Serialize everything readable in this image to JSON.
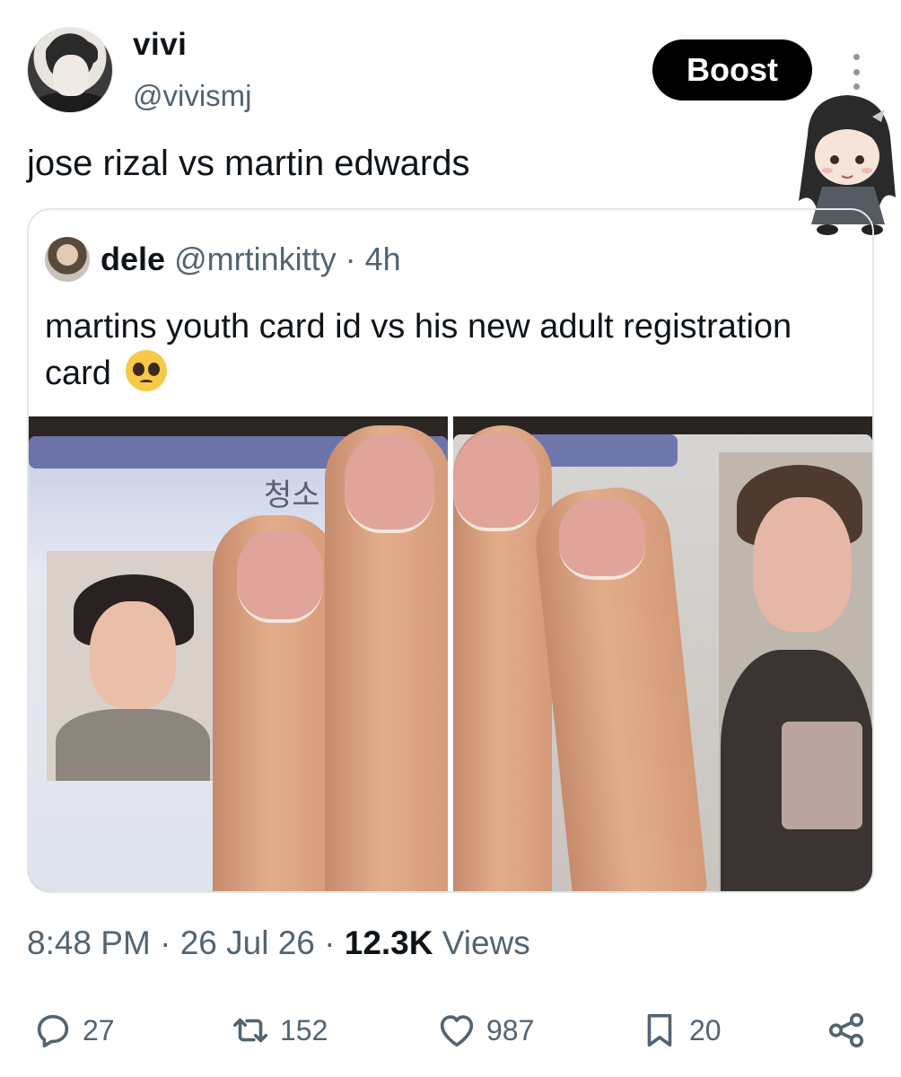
{
  "author": {
    "name": "vivi",
    "handle": "@vivismj"
  },
  "boost_label": "Boost",
  "tweet_text": "jose rizal vs martin edwards",
  "quoted": {
    "name": "dele",
    "handle": "@mrtinkitty",
    "separator": "·",
    "time": "4h",
    "text": "martins youth card id vs his new adult registration card",
    "emoji": "pleading-face",
    "card_label": "청소"
  },
  "meta": {
    "time": "8:48 PM",
    "date": "26 Jul 26",
    "separator": "·",
    "views_count": "12.3K",
    "views_label": "Views"
  },
  "actions": {
    "replies": "27",
    "reposts": "152",
    "likes": "987",
    "bookmarks": "20"
  },
  "icons": [
    "more-vertical-icon",
    "reply-icon",
    "repost-icon",
    "like-icon",
    "bookmark-icon",
    "share-icon"
  ]
}
